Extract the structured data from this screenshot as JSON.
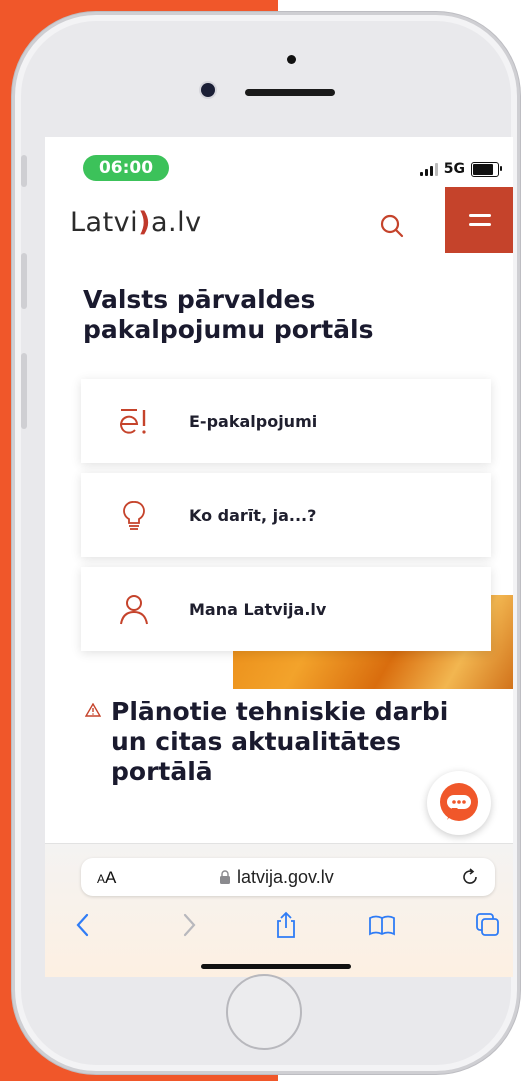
{
  "colors": {
    "brand": "#c5432b",
    "status_pill": "#3cc25a",
    "background_accent": "#f0572a"
  },
  "status_bar": {
    "time": "06:00",
    "network": "5G",
    "battery_level": 0.85
  },
  "header": {
    "logo_text_1": "Latvi",
    "logo_text_2": "a.lv",
    "search_icon": "search-icon",
    "menu_icon": "hamburger-icon"
  },
  "main": {
    "title": "Valsts pārvaldes pakalpojumu portāls",
    "cards": [
      {
        "label": "E-pakalpojumi",
        "icon": "e-services-icon"
      },
      {
        "label": "Ko darīt, ja...?",
        "icon": "lightbulb-icon"
      },
      {
        "label": "Mana Latvija.lv",
        "icon": "user-icon"
      }
    ],
    "news_heading": "Plānotie tehniskie darbi un citas aktualitātes portālā",
    "chat_icon": "chat-icon"
  },
  "browser": {
    "aa_label": "AA",
    "url": "latvija.gov.lv",
    "icons": [
      "back-icon",
      "forward-icon",
      "share-icon",
      "bookmarks-icon",
      "tabs-icon"
    ]
  }
}
